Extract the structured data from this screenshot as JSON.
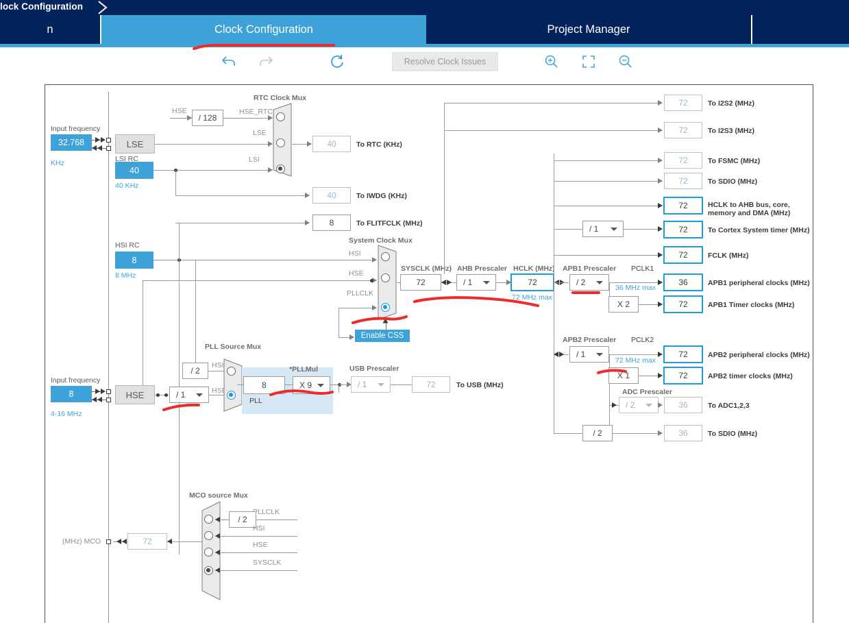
{
  "breadcrumb": {
    "text": "lock Configuration",
    "chevron_icon": "chevron-right-icon"
  },
  "tabs": [
    {
      "label": "n",
      "active": false
    },
    {
      "label": "Clock Configuration",
      "active": true
    },
    {
      "label": "Project Manager",
      "active": false
    },
    {
      "label": "",
      "active": false
    }
  ],
  "toolbar": {
    "undo_icon": "undo-icon",
    "redo_icon": "redo-icon",
    "reset_icon": "refresh-icon",
    "resolve_label": "Resolve Clock Issues",
    "zoom_in_icon": "zoom-in-icon",
    "fit_icon": "fit-to-screen-icon",
    "zoom_out_icon": "zoom-out-icon"
  },
  "diagram": {
    "lse": {
      "input_frequency_label": "Input frequency",
      "value": "32.768",
      "unit_label": "KHz",
      "osc_label": "LSE"
    },
    "lsi": {
      "title": "LSI RC",
      "value": "40",
      "sub": "40 KHz"
    },
    "hse_rtc_divider": "/ 128",
    "hse_div_label": "HSE",
    "hse_rtc_label": "HSE_RTC",
    "rtc_mux": {
      "title": "RTC Clock Mux",
      "inputs": [
        "HSE_RTC",
        "LSE",
        "LSI"
      ],
      "selected": 2
    },
    "to_rtc": {
      "value": "40",
      "label": "To RTC (KHz)"
    },
    "to_iwdg": {
      "value": "40",
      "label": "To IWDG (KHz)"
    },
    "to_flitfclk": {
      "value": "8",
      "label": "To FLITFCLK (MHz)"
    },
    "hsi": {
      "title": "HSI RC",
      "value": "8",
      "sub": "8 MHz"
    },
    "sys_mux": {
      "title": "System Clock Mux",
      "inputs": [
        "HSI",
        "HSE",
        "PLLCLK"
      ],
      "selected": 2
    },
    "enable_css": "Enable CSS",
    "sysclk": {
      "title": "SYSCLK (MHz)",
      "value": "72"
    },
    "ahb_prescaler": {
      "title": "AHB Prescaler",
      "value": "/ 1"
    },
    "hclk": {
      "title": "HCLK (MHz)",
      "value": "72",
      "max": "72 MHz max"
    },
    "hse": {
      "input_frequency_label": "Input frequency",
      "value": "8",
      "range": "4-16 MHz",
      "osc_label": "HSE",
      "prediv": "/ 1"
    },
    "pll_source_mux": {
      "title": "PLL Source Mux",
      "hsi_div": "/ 2",
      "inputs": [
        "HSI",
        "HSE"
      ],
      "selected": 1
    },
    "pll": {
      "label": "PLL",
      "input_value": "8",
      "mul_title": "*PLLMul",
      "mul_value": "X 9"
    },
    "usb_prescaler": {
      "title": "USB Prescaler",
      "value": "/ 1"
    },
    "to_usb": {
      "value": "72",
      "label": "To USB (MHz)"
    },
    "outputs": [
      {
        "name": "i2s2",
        "value": "72",
        "label": "To I2S2 (MHz)",
        "highlight": false
      },
      {
        "name": "i2s3",
        "value": "72",
        "label": "To I2S3 (MHz)",
        "highlight": false
      },
      {
        "name": "fsmc",
        "value": "72",
        "label": "To FSMC (MHz)",
        "highlight": false
      },
      {
        "name": "sdio",
        "value": "72",
        "label": "To SDIO (MHz)",
        "highlight": false
      },
      {
        "name": "hclk-ahb",
        "value": "72",
        "label": "HCLK to AHB bus, core,",
        "label2": "memory and DMA (MHz)",
        "highlight": true
      },
      {
        "name": "cortex",
        "value": "72",
        "label": "To Cortex System timer (MHz)",
        "highlight": true
      },
      {
        "name": "fclk",
        "value": "72",
        "label": "FCLK (MHz)",
        "highlight": true
      }
    ],
    "cortex_prescaler": "/ 1",
    "apb1": {
      "title": "APB1 Prescaler",
      "prescaler": "/ 2",
      "pclk_label": "PCLK1",
      "max": "36 MHz max",
      "mult": "X 2",
      "peripheral": {
        "value": "36",
        "label": "APB1 peripheral clocks (MHz)"
      },
      "timer": {
        "value": "72",
        "label": "APB1 Timer clocks (MHz)"
      }
    },
    "apb2": {
      "title": "APB2 Prescaler",
      "prescaler": "/ 1",
      "pclk_label": "PCLK2",
      "max": "72 MHz max",
      "mult": "X 1",
      "peripheral": {
        "value": "72",
        "label": "APB2 peripheral clocks (MHz)"
      },
      "timer": {
        "value": "72",
        "label": "APB2 timer clocks (MHz)"
      }
    },
    "adc": {
      "title": "ADC Prescaler",
      "prescaler": "/ 2",
      "value": "36",
      "label": "To ADC1,2,3"
    },
    "sdio_div": {
      "prescaler": "/ 2",
      "value": "36",
      "label": "To SDIO (MHz)"
    },
    "mco": {
      "title": "MCO source Mux",
      "out_label": "(MHz) MCO",
      "value": "72",
      "pll_div": "/ 2",
      "inputs": [
        "PLLCLK",
        "HSI",
        "HSE",
        "SYSCLK"
      ],
      "selected": 3
    }
  },
  "colors": {
    "header_navy": "#04235c",
    "accent_blue": "#3da2d8",
    "highlight_border": "#1e9ad6",
    "annotation_red": "#ee2b2b"
  }
}
